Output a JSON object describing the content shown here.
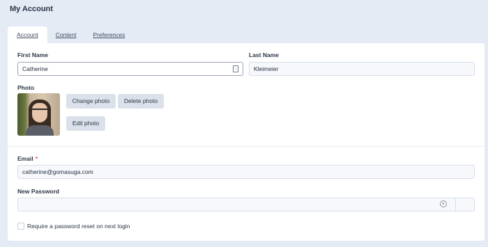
{
  "page_title": "My Account",
  "tabs": [
    {
      "label": "Account",
      "active": true
    },
    {
      "label": "Content",
      "active": false
    },
    {
      "label": "Preferences",
      "active": false
    }
  ],
  "form": {
    "first_name": {
      "label": "First Name",
      "value": "Catherine"
    },
    "last_name": {
      "label": "Last Name",
      "value": "Kleimeier"
    },
    "photo": {
      "label": "Photo",
      "change_button": "Change photo",
      "delete_button": "Delete photo",
      "edit_button": "Edit photo"
    },
    "email": {
      "label": "Email",
      "required_mark": "*",
      "value": "catherine@gomasuga.com"
    },
    "new_password": {
      "label": "New Password",
      "value": ""
    },
    "reset_checkbox": {
      "label": "Require a password reset on next login",
      "checked": false
    }
  },
  "colors": {
    "background": "#e4ebf5",
    "button": "#dbe1ea",
    "required": "#e2465a"
  }
}
